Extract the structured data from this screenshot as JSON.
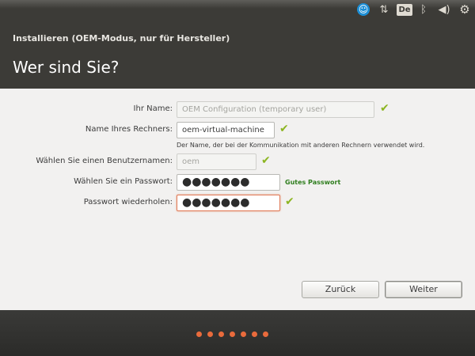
{
  "top_panel": {
    "icons": [
      "accessibility-icon",
      "network-icon",
      "keyboard-layout-icon",
      "bluetooth-icon",
      "volume-icon",
      "gear-icon"
    ],
    "keyboard_layout": "De",
    "accessibility_glyph": "☺",
    "network_glyph": "⇅",
    "bluetooth_glyph": "ᛒ",
    "volume_glyph": "◀)",
    "gear_glyph": "⚙"
  },
  "window": {
    "title": "Installieren (OEM-Modus, nur für Hersteller)",
    "page_title": "Wer sind Sie?"
  },
  "form": {
    "name_label": "Ihr Name:",
    "name_value": "OEM Configuration (temporary user)",
    "computer_label": "Name Ihres Rechners:",
    "computer_value": "oem-virtual-machine",
    "computer_hint": "Der Name, der bei der Kommunikation mit anderen Rechnern verwendet wird.",
    "username_label": "Wählen Sie einen Benutzernamen:",
    "username_value": "oem",
    "password_label": "Wählen Sie ein Passwort:",
    "password_value": "●●●●●●●",
    "password_strength": "Gutes Passwort",
    "repeat_label": "Passwort wiederholen:",
    "repeat_value": "●●●●●●●",
    "check_glyph": "✔"
  },
  "buttons": {
    "back": "Zurück",
    "next": "Weiter"
  },
  "progress": {
    "total_steps": 7,
    "color": "#e96b3c"
  }
}
